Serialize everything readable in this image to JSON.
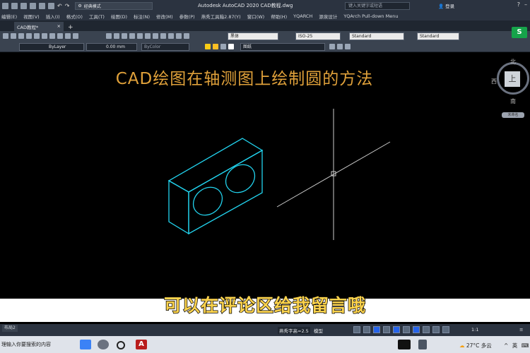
{
  "titlebar": {
    "workspace": "经典模式",
    "title": "Autodesk AutoCAD 2020    CAD教程.dwg",
    "search_placeholder": "键入关键字或短语",
    "login": "登录"
  },
  "menu": [
    "编辑(E)",
    "视图(V)",
    "插入(I)",
    "格式(O)",
    "工具(T)",
    "绘图(D)",
    "标注(N)",
    "修改(M)",
    "参数(P)",
    "燕秀工具箱2.87(Y)",
    "窗口(W)",
    "帮助(H)",
    "YQARCH",
    "源泉设计",
    "YQArch Pull-down Menu"
  ],
  "tabs": {
    "doc_tab": "CAD教程*",
    "close": "×",
    "add": "+"
  },
  "ribbon": {
    "font": "黑体",
    "dimstyle": "ISO-25",
    "tablestyle": "Standard",
    "mleaderstyle": "Standard",
    "linetype": "ByLayer",
    "lineweight": "0.00 mm",
    "color": "ByColor",
    "layer": "图纸"
  },
  "canvas": {
    "heading": "CAD绘图在轴测图上绘制圆的方法",
    "caption": "可以在评论区给我留言哦"
  },
  "viewcube": {
    "north": "北",
    "west": "西",
    "south": "南",
    "face": "上",
    "wcs": "未命名"
  },
  "status": {
    "layout_tab": "布局2",
    "annotation": "燕秀字高=2.5",
    "model": "模型",
    "scale": "1:1"
  },
  "taskbar": {
    "search": "理输入你要搜索的内容",
    "weather": "27°C 多云",
    "ime": "英"
  },
  "colors": {
    "drawing": "#22d3ee",
    "heading": "#e0a13a",
    "caption": "#fcd34d",
    "crosshair": "#cccccc"
  }
}
